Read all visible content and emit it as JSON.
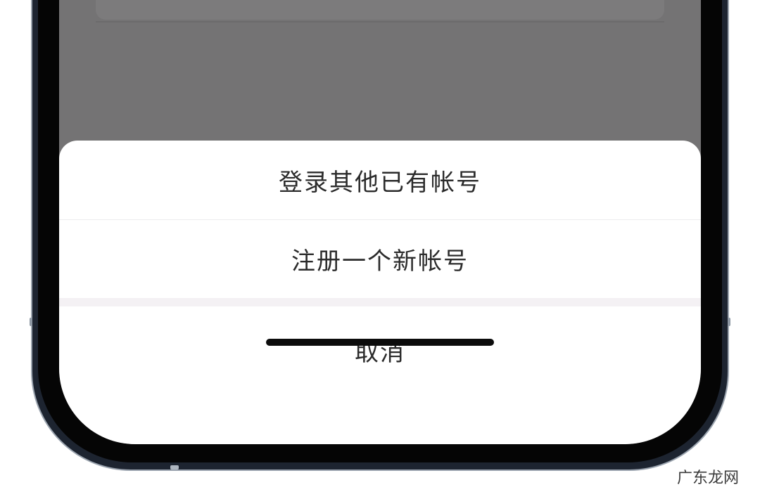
{
  "action_sheet": {
    "options": [
      {
        "label": "登录其他已有帐号"
      },
      {
        "label": "注册一个新帐号"
      }
    ],
    "cancel_label": "取消"
  },
  "watermark": "广东龙网"
}
